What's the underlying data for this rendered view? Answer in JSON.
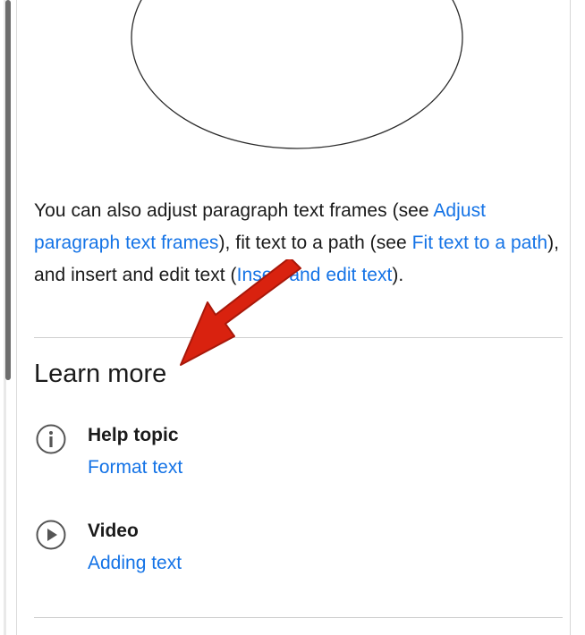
{
  "paragraph": {
    "t1": "You can also adjust paragraph text frames (see ",
    "link1": "Adjust paragraph text frames",
    "t2": "), fit text to a path (see ",
    "link2": "Fit text to a path",
    "t3": "), and insert and edit text (",
    "link3": "Insert and edit text",
    "t4": ")."
  },
  "learn_more": {
    "heading": "Learn more",
    "resources": [
      {
        "icon": "info-icon",
        "type": "Help topic",
        "link": "Format text"
      },
      {
        "icon": "play-icon",
        "type": "Video",
        "link": "Adding text"
      }
    ]
  },
  "colors": {
    "link": "#1473e6",
    "annotation_arrow": "#d9220f"
  }
}
